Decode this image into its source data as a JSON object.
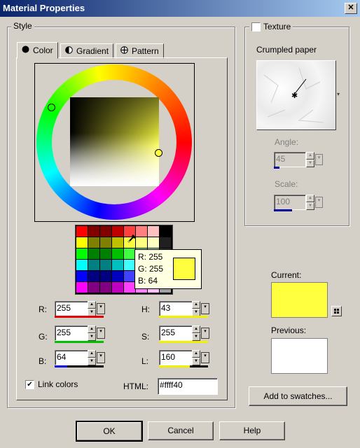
{
  "window": {
    "title": "Material Properties",
    "close_glyph": "✕"
  },
  "style_group": {
    "label": "Style",
    "tabs": [
      {
        "label": "Color",
        "icon": "filled-circle-icon"
      },
      {
        "label": "Gradient",
        "icon": "half-circle-icon"
      },
      {
        "label": "Pattern",
        "icon": "crosshair-circle-icon"
      }
    ],
    "swatch_colors": [
      [
        "#ff0000",
        "#800000",
        "#800000",
        "#c00000",
        "#ff4040",
        "#ff8080",
        "#ffc0c0",
        "#000000"
      ],
      [
        "#ffff00",
        "#808000",
        "#808000",
        "#c0c000",
        "#ffff40",
        "#ffff80",
        "#ffffc0",
        "#202020"
      ],
      [
        "#00ff00",
        "#008000",
        "#008000",
        "#00c000",
        "#40ff40",
        "#80ff80",
        "#c0ffc0",
        "#404040"
      ],
      [
        "#00ffff",
        "#008080",
        "#008080",
        "#00c0c0",
        "#40ffff",
        "#80ffff",
        "#c0ffff",
        "#606060"
      ],
      [
        "#0000ff",
        "#000080",
        "#000080",
        "#0000c0",
        "#4040ff",
        "#8080ff",
        "#c0c0ff",
        "#808080"
      ],
      [
        "#ff00ff",
        "#800080",
        "#800080",
        "#c000c0",
        "#ff40ff",
        "#ff80ff",
        "#ffc0ff",
        "#a0a0a0"
      ]
    ],
    "tooltip": {
      "r": "R: 255",
      "g": "G: 255",
      "b": "B: 64",
      "swatch": "#ffff40"
    },
    "fields": {
      "r_label": "R:",
      "r_value": "255",
      "g_label": "G:",
      "g_value": "255",
      "b_label": "B:",
      "b_value": "64",
      "h_label": "H:",
      "h_value": "43",
      "s_label": "S:",
      "s_value": "255",
      "l_label": "L:",
      "l_value": "160",
      "html_label": "HTML:",
      "html_value": "#ffff40"
    },
    "link_colors": {
      "label": "Link colors",
      "checked": true,
      "mark": "✔"
    }
  },
  "texture_group": {
    "label": "Texture",
    "checked": false,
    "texture_name": "Crumpled paper",
    "angle_label": "Angle:",
    "angle_value": "45",
    "scale_label": "Scale:",
    "scale_value": "100"
  },
  "current": {
    "label": "Current:",
    "color": "#ffff40"
  },
  "previous": {
    "label": "Previous:",
    "color": "#ffffff"
  },
  "buttons": {
    "add_swatches": "Add to swatches...",
    "ok": "OK",
    "cancel": "Cancel",
    "help": "Help"
  }
}
